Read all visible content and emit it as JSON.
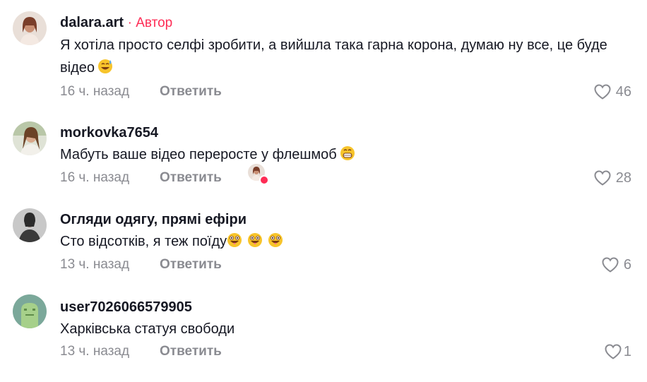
{
  "comments": [
    {
      "username": "dalara.art",
      "author_tag": "· Автор",
      "text": "Я хотіла просто селфі зробити, а вийшла така гарна корона, думаю ну все, це буде відео",
      "time": "16 ч. назад",
      "reply_label": "Ответить",
      "likes": "46",
      "emoji": "sweat-smile"
    },
    {
      "username": "morkovka7654",
      "text": "Мабуть ваше відео переросте у флешмоб",
      "time": "16 ч. назад",
      "reply_label": "Ответить",
      "likes": "28",
      "emoji": "grin"
    },
    {
      "username": "Огляди одягу, прямі ефіри",
      "text": "Сто відсотків, я теж поїду",
      "time": "13 ч. назад",
      "reply_label": "Ответить",
      "likes": "6",
      "emoji": "zany-x3"
    },
    {
      "username": "user7026066579905",
      "text": "Харківська статуя свободи",
      "time": "13 ч. назад",
      "reply_label": "Ответить",
      "likes": "1"
    }
  ],
  "colors": {
    "accent": "#fe2c55",
    "secondary_text": "#8a8b91",
    "primary_text": "#161823"
  }
}
